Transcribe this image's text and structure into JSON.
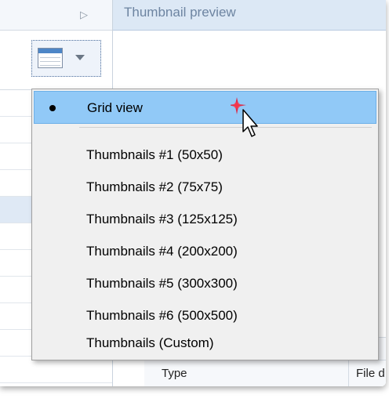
{
  "preview_pane": {
    "title": "Thumbnail preview"
  },
  "properties": [
    {
      "key": "Type",
      "value": "File d"
    }
  ],
  "view_menu": {
    "items": [
      {
        "label": "Grid view",
        "selected": true,
        "hovered": true
      },
      {
        "label": "Thumbnails #1 (50x50)",
        "selected": false
      },
      {
        "label": "Thumbnails #2 (75x75)",
        "selected": false
      },
      {
        "label": "Thumbnails #3 (125x125)",
        "selected": false
      },
      {
        "label": "Thumbnails #4 (200x200)",
        "selected": false
      },
      {
        "label": "Thumbnails #5 (300x300)",
        "selected": false
      },
      {
        "label": "Thumbnails #6 (500x500)",
        "selected": false
      },
      {
        "label": "Thumbnails (Custom)",
        "selected": false
      }
    ]
  },
  "colors": {
    "menu_background": "#f0f0f0",
    "menu_hover": "#91c9f7",
    "header_background": "#dce8f5",
    "click_indicator": "#e8122b"
  },
  "icons": {
    "view_button": "grid-view-icon",
    "dropdown": "chevron-down-icon",
    "collapse": "triangle-right-icon",
    "pointer": "mouse-cursor-icon",
    "click": "click-star-icon"
  }
}
